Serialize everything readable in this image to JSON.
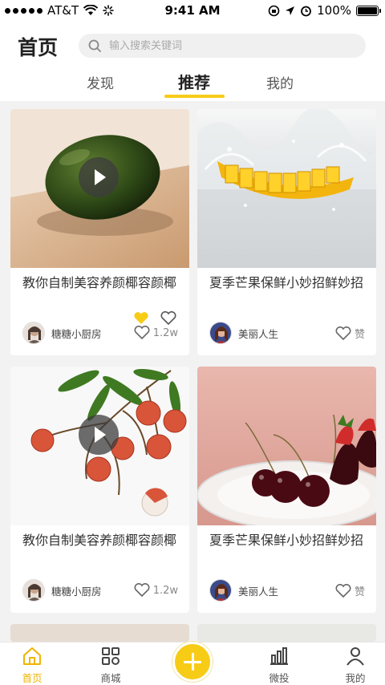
{
  "status_bar": {
    "carrier": "AT&T",
    "time": "9:41 AM",
    "battery": "100%"
  },
  "header": {
    "title": "首页",
    "search_placeholder": "输入搜索关键词"
  },
  "tabs": [
    {
      "label": "发现"
    },
    {
      "label": "推荐"
    },
    {
      "label": "我的"
    }
  ],
  "feed": [
    {
      "title": "教你自制美容养颜椰容颜椰",
      "author": "糖糖小厨房",
      "likes": "1.2w",
      "image": "avocado",
      "video": true
    },
    {
      "title": "夏季芒果保鲜小妙招鲜妙招",
      "author": "美丽人生",
      "likes": "赞",
      "image": "mango",
      "video": false
    },
    {
      "title": "教你自制美容养颜椰容颜椰",
      "author": "糖糖小厨房",
      "likes": "1.2w",
      "image": "lychee",
      "video": true
    },
    {
      "title": "夏季芒果保鲜小妙招鲜妙招",
      "author": "美丽人生",
      "likes": "赞",
      "image": "cherries",
      "video": false
    }
  ],
  "tab_bar": [
    {
      "label": "首页",
      "icon": "home-icon",
      "active": true
    },
    {
      "label": "商城",
      "icon": "store-icon",
      "active": false
    },
    {
      "label": "微投",
      "icon": "chart-icon",
      "active": false
    },
    {
      "label": "我的",
      "icon": "user-icon",
      "active": false
    }
  ],
  "colors": {
    "accent": "#f7cc17",
    "active_tab": "#f0b400"
  }
}
